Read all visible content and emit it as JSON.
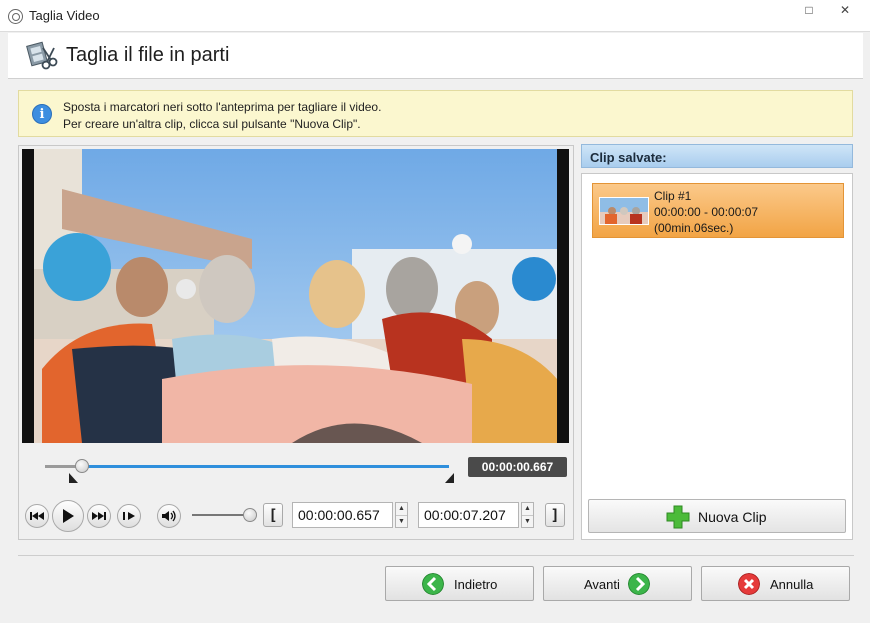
{
  "window": {
    "title": "Taglia Video",
    "maximize_glyph": "□",
    "close_glyph": "✕"
  },
  "header": {
    "title": "Taglia il file in parti",
    "icon": "film-scissors-icon"
  },
  "info": {
    "line1": "Sposta i marcatori neri sotto l'anteprima per tagliare il video.",
    "line2": "Per creare un'altra clip, clicca sul pulsante \"Nuova Clip\".",
    "icon": "info-icon"
  },
  "player": {
    "current_time": "00:00:00.667",
    "progress_fraction": 0.09,
    "volume_fraction": 0.85,
    "start_time": "00:00:00.657",
    "end_time": "00:00:07.207",
    "bracket_open": "[",
    "bracket_close": "]"
  },
  "clips": {
    "header": "Clip salvate:",
    "items": [
      {
        "name": "Clip #1",
        "range": "00:00:00 - 00:00:07",
        "duration": "(00min.06sec.)"
      }
    ],
    "new_clip_label": "Nuova Clip"
  },
  "nav": {
    "back_label": "Indietro",
    "next_label": "Avanti",
    "cancel_label": "Annulla"
  },
  "colors": {
    "accent": "#2f8fdc",
    "clip_selected": "#f2a445",
    "info_bg": "#fbf7cf"
  }
}
